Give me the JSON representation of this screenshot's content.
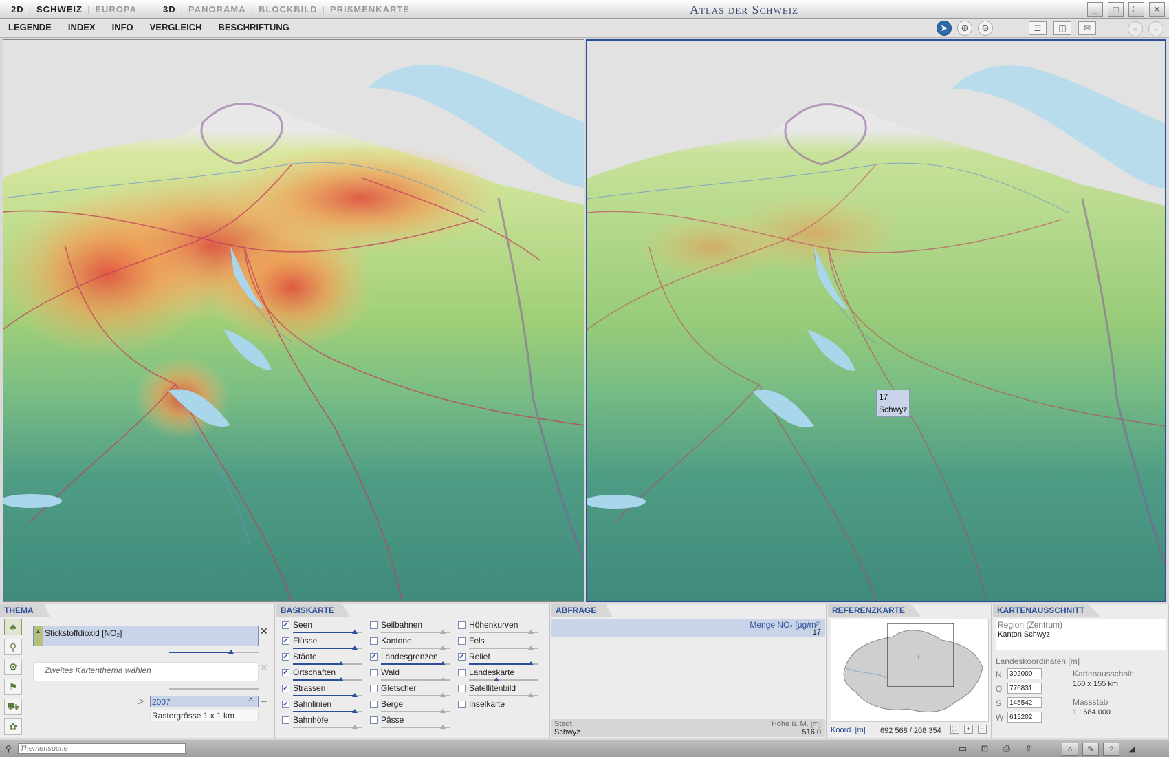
{
  "app": {
    "title": "Atlas der Schweiz"
  },
  "modes": [
    "2D",
    "SCHWEIZ",
    "EUROPA",
    "3D",
    "PANORAMA",
    "BLOCKBILD",
    "PRISMENKARTE"
  ],
  "menu": [
    "LEGENDE",
    "INDEX",
    "INFO",
    "VERGLEICH",
    "BESCHRIFTUNG"
  ],
  "window_buttons": [
    "_",
    "□",
    "⛶",
    "✕"
  ],
  "tooltip": {
    "value": "17",
    "place": "Schwyz"
  },
  "thema": {
    "title": "THEMA",
    "selected_theme": "Stickstoffdioxid [NO₂]",
    "second_theme_placeholder": "Zweites Kartenthema wählen",
    "year": "2007",
    "raster": "Rastergrösse 1 x 1 km"
  },
  "basiskarte": {
    "title": "BASISKARTE",
    "layers": [
      {
        "label": "Seen",
        "checked": "✓",
        "level": 0.9
      },
      {
        "label": "Flüsse",
        "checked": "✓",
        "level": 0.9
      },
      {
        "label": "Städte",
        "checked": "✓",
        "level": 0.7
      },
      {
        "label": "Ortschaften",
        "checked": "✓",
        "level": 0.7
      },
      {
        "label": "Strassen",
        "checked": "✓",
        "level": 0.9
      },
      {
        "label": "Bahnlinien",
        "checked": "✓",
        "level": 0.9
      },
      {
        "label": "Bahnhöfe",
        "checked": "",
        "level": 0.9
      },
      {
        "label": "Seilbahnen",
        "checked": "",
        "level": 0.9
      },
      {
        "label": "Kantone",
        "checked": "",
        "level": 0.9
      },
      {
        "label": "Landesgrenzen",
        "checked": "✓",
        "level": 0.9
      },
      {
        "label": "Wald",
        "checked": "",
        "level": 0.9
      },
      {
        "label": "Gletscher",
        "checked": "",
        "level": 0.9
      },
      {
        "label": "Berge",
        "checked": "",
        "level": 0.9
      },
      {
        "label": "Pässe",
        "checked": "",
        "level": 0.9
      },
      {
        "label": "Höhenkurven",
        "checked": "",
        "level": 0.9
      },
      {
        "label": "Fels",
        "checked": "",
        "level": 0.9
      },
      {
        "label": "Relief",
        "checked": "✓",
        "level": 0.9
      },
      {
        "label": "Landeskarte",
        "checked": "",
        "level": 0.4
      },
      {
        "label": "Satellitenbild",
        "checked": "",
        "level": 0.9
      },
      {
        "label": "Inselkarte",
        "checked": "",
        "level": 0.9
      }
    ]
  },
  "abfrage": {
    "title": "ABFRAGE",
    "header": "Menge NO₂ [µg/m³]",
    "value": "17",
    "city_label": "Stadt",
    "city_value": "Schwyz",
    "height_label": "Höhe ü. M. [m]",
    "height_value": "516.0"
  },
  "referenzkarte": {
    "title": "REFERENZKARTE",
    "coord_label": "Koord. [m]",
    "coord_value": "692 568 / 208 354"
  },
  "kartenausschnitt": {
    "title": "KARTENAUSSCHNITT",
    "region": "Region (Zentrum)",
    "region_value": "Kanton Schwyz",
    "coords_label": "Landeskoordinaten [m]",
    "N": "302000",
    "O": "776831",
    "S": "145542",
    "W": "615202",
    "extent_label": "Kartenausschnitt",
    "extent_value": "160 x 155 km",
    "scale_label": "Massstab",
    "scale_value": "1 : 684 000"
  },
  "status": {
    "search_placeholder": "Themensuche"
  }
}
